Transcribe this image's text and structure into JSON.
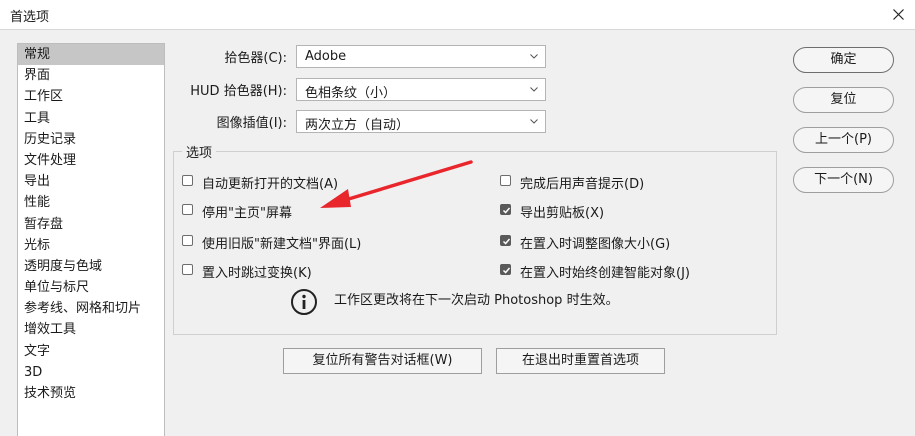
{
  "window": {
    "title": "首选项"
  },
  "sidebar": {
    "items": [
      {
        "label": "常规",
        "selected": true
      },
      {
        "label": "界面"
      },
      {
        "label": "工作区"
      },
      {
        "label": "工具"
      },
      {
        "label": "历史记录"
      },
      {
        "label": "文件处理"
      },
      {
        "label": "导出"
      },
      {
        "label": "性能"
      },
      {
        "label": "暂存盘"
      },
      {
        "label": "光标"
      },
      {
        "label": "透明度与色域"
      },
      {
        "label": "单位与标尺"
      },
      {
        "label": "参考线、网格和切片"
      },
      {
        "label": "增效工具"
      },
      {
        "label": "文字"
      },
      {
        "label": "3D"
      },
      {
        "label": "技术预览"
      }
    ]
  },
  "form": {
    "color_picker": {
      "label": "拾色器(C):",
      "value": "Adobe"
    },
    "hud_color_picker": {
      "label": "HUD 拾色器(H):",
      "value": "色相条纹（小）"
    },
    "interpolation": {
      "label": "图像插值(I):",
      "value": "两次立方（自动）"
    }
  },
  "options": {
    "title": "选项",
    "checkboxes": [
      {
        "label": "自动更新打开的文档(A)",
        "checked": false
      },
      {
        "label": "停用\"主页\"屏幕",
        "checked": false
      },
      {
        "label": "使用旧版\"新建文档\"界面(L)",
        "checked": false
      },
      {
        "label": "置入时跳过变换(K)",
        "checked": false
      },
      {
        "label": "完成后用声音提示(D)",
        "checked": false
      },
      {
        "label": "导出剪贴板(X)",
        "checked": true
      },
      {
        "label": "在置入时调整图像大小(G)",
        "checked": true
      },
      {
        "label": "在置入时始终创建智能对象(J)",
        "checked": true
      }
    ],
    "info_text": "工作区更改将在下一次启动 Photoshop 时生效。"
  },
  "buttons": {
    "reset_warnings": "复位所有警告对话框(W)",
    "reset_on_quit": "在退出时重置首选项",
    "ok": "确定",
    "reset": "复位",
    "prev": "上一个(P)",
    "next": "下一个(N)"
  },
  "colors": {
    "annotation_arrow": "#e8262b",
    "selected_item": "#c6c6c6"
  },
  "icons": {
    "close": "close-icon",
    "info": "info-icon",
    "chevron": "chevron-down-icon"
  }
}
